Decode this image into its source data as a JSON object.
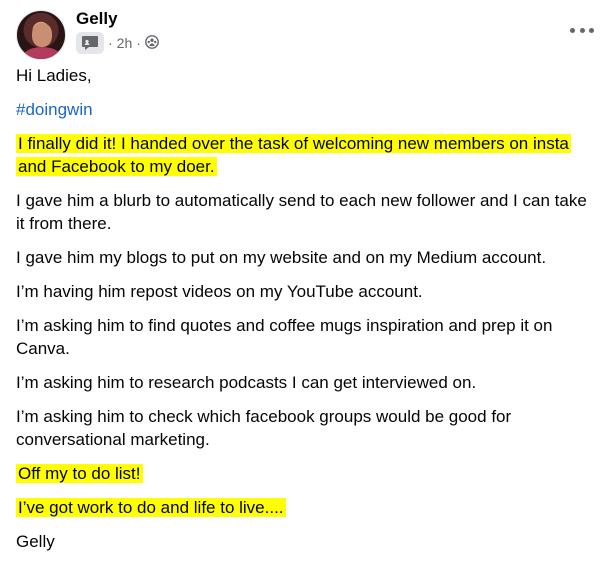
{
  "post": {
    "author": "Gelly",
    "time": "2h",
    "dot": "·",
    "icons": {
      "group_badge": "chat-badge-icon",
      "audience": "group-audience-icon",
      "menu": "more-horizontal-icon"
    },
    "colors": {
      "highlight": "#ffff00",
      "hashtag": "#1a66c8",
      "meta": "#65676b"
    },
    "greeting": "Hi Ladies,",
    "hashtag": "#doingwin",
    "highlight_1": "I finally did it! I handed over the task of welcoming new members on insta and Facebook to my doer.",
    "p1": "I gave him a blurb to automatically send to each new follower and I can take it from there.",
    "p2": "I gave him my blogs to put on my website and on my Medium account.",
    "p3": "I’m having him repost videos on my YouTube account.",
    "p4": "I’m asking him to find quotes and coffee mugs inspiration and prep it on Canva.",
    "p5": "I’m asking him to research podcasts I can get interviewed on.",
    "p6": "I’m asking him to check which facebook groups would be good for conversational marketing.",
    "highlight_2": "Off my to do list!",
    "highlight_3": "I’ve got work to do and life to live....",
    "signature": "Gelly"
  }
}
